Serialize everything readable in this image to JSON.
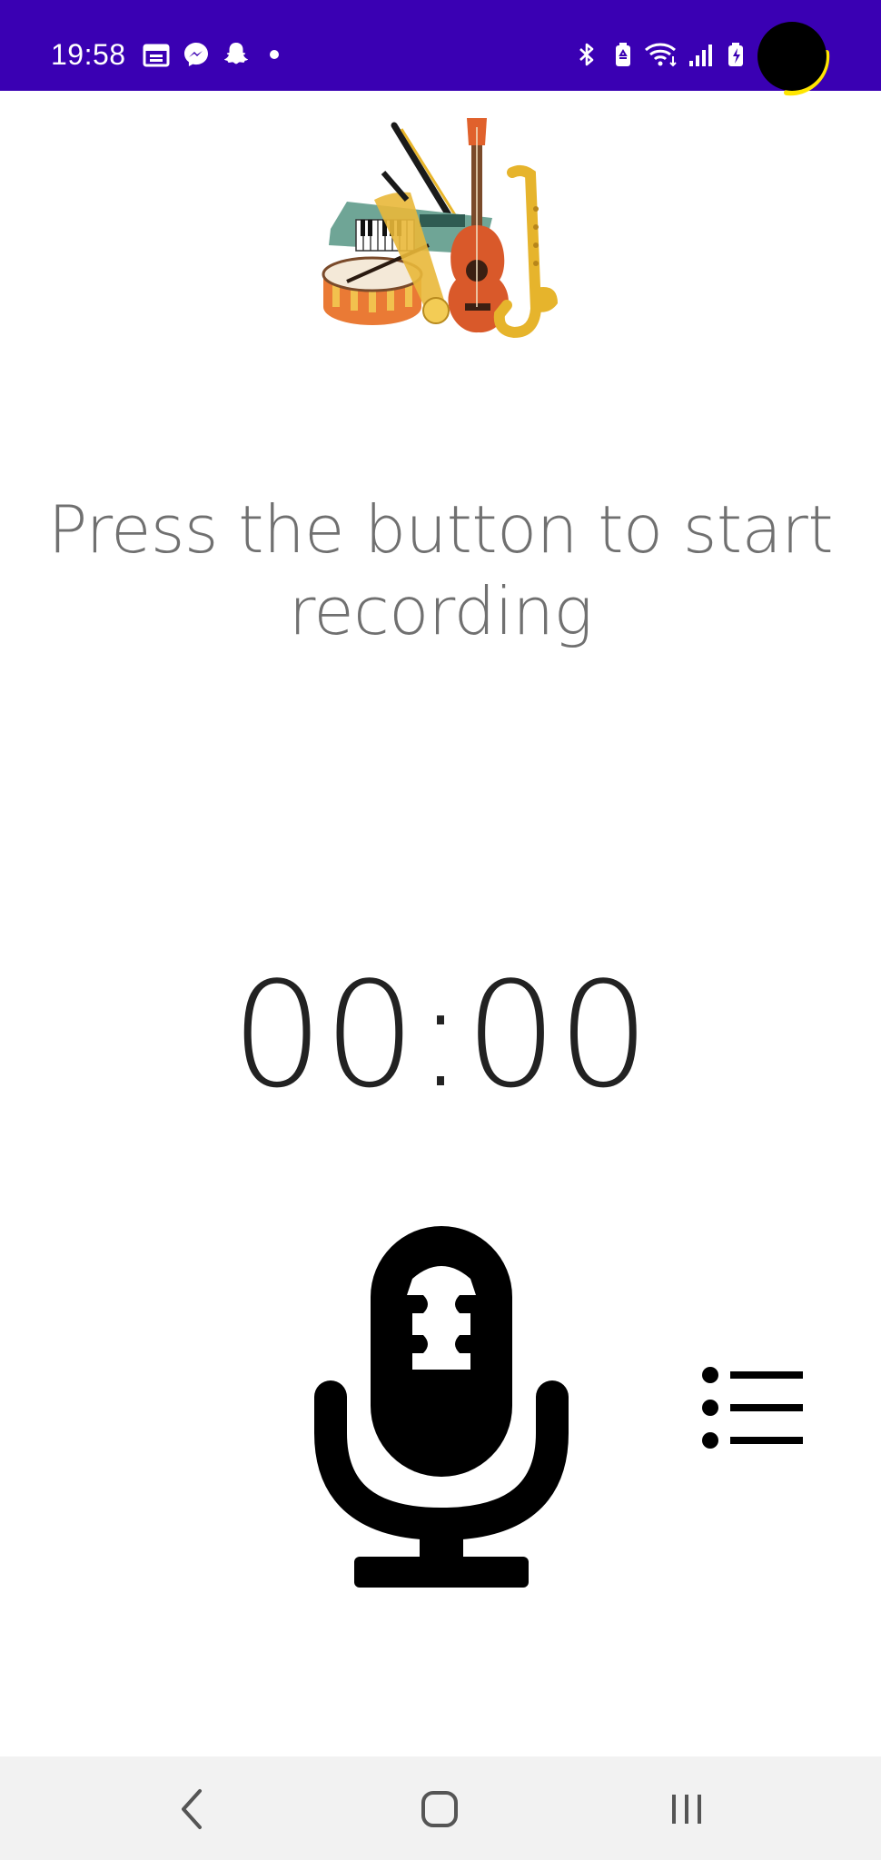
{
  "status_bar": {
    "time": "19:58",
    "background_color": "#3a00b3",
    "left_icons": [
      "calendar-icon",
      "messenger-icon",
      "snapchat-icon",
      "notification-dot-icon"
    ],
    "right_icons": [
      "bluetooth-icon",
      "battery-saver-icon",
      "wifi-icon",
      "signal-icon",
      "battery-charging-icon"
    ]
  },
  "main": {
    "logo_icon": "musical-instruments-logo",
    "instruction": "Press the button to start recording",
    "timer": "00:00",
    "record_icon": "microphone-icon",
    "list_icon": "list-icon"
  },
  "nav_bar": {
    "buttons": [
      "back-icon",
      "home-icon",
      "recent-apps-icon"
    ],
    "background_color": "#f2f2f2"
  }
}
